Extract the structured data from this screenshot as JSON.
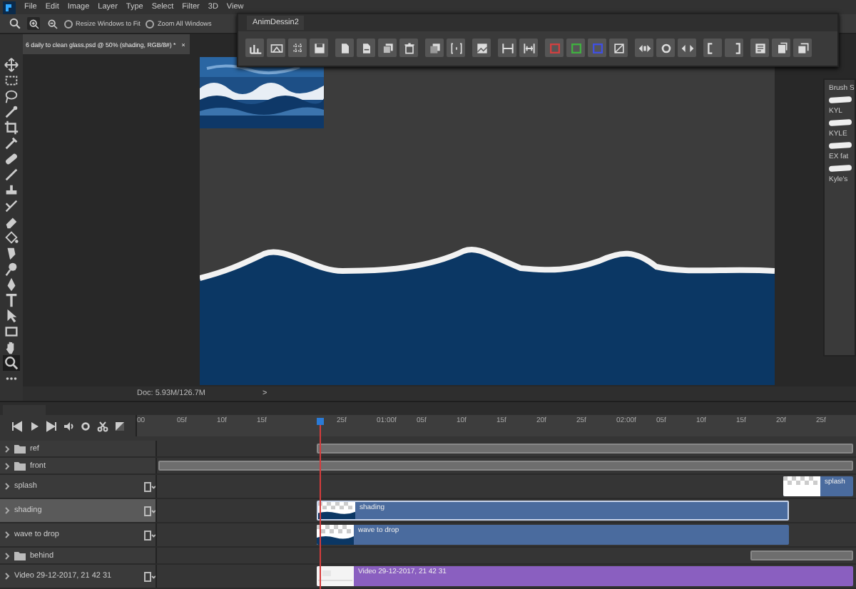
{
  "menu": [
    "File",
    "Edit",
    "Image",
    "Layer",
    "Type",
    "Select",
    "Filter",
    "3D",
    "View"
  ],
  "options": [
    {
      "label": "Resize Windows to Fit",
      "checked": false
    },
    {
      "label": "Zoom All Windows",
      "checked": false
    }
  ],
  "document_tab": {
    "title": "6 daily to clean glass.psd @ 50% (shading, RGB/8#) *",
    "close": "×"
  },
  "panel": {
    "title": "AnimDessin2"
  },
  "brush_panel": {
    "title": "Brush S",
    "items": [
      "KYL",
      "KYLE",
      "EX fat",
      "Kyle's"
    ]
  },
  "status_bar": {
    "doc": "Doc: 5.93M/126.7M",
    "arrow": ">"
  },
  "timeline": {
    "ruler": [
      "00",
      "05f",
      "10f",
      "15f",
      "25f",
      "01:00f",
      "05f",
      "10f",
      "15f",
      "20f",
      "25f",
      "02:00f",
      "05f",
      "10f",
      "15f",
      "20f",
      "25f"
    ],
    "layers": [
      {
        "name": "ref",
        "kind": "folder",
        "selected": false
      },
      {
        "name": "front",
        "kind": "folder",
        "selected": false
      },
      {
        "name": "splash",
        "kind": "layer",
        "selected": false,
        "clip": "splash"
      },
      {
        "name": "shading",
        "kind": "layer",
        "selected": true,
        "clip": "shading"
      },
      {
        "name": "wave to drop",
        "kind": "layer",
        "selected": false,
        "clip": "wave to drop"
      },
      {
        "name": "behind",
        "kind": "folder",
        "selected": false
      },
      {
        "name": "Video 29-12-2017, 21 42 31",
        "kind": "video",
        "selected": false,
        "clip": "Video 29-12-2017, 21 42 31"
      }
    ]
  }
}
